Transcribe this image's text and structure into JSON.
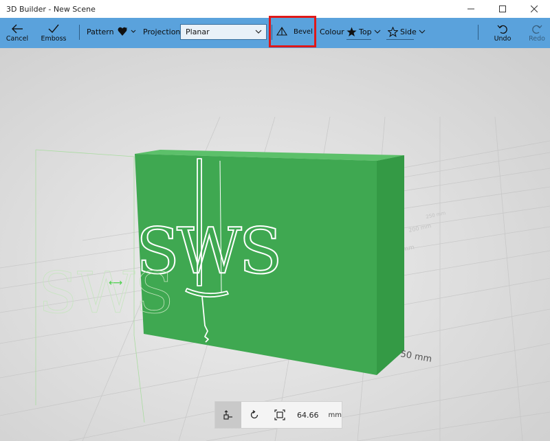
{
  "window": {
    "title": "3D Builder - New Scene"
  },
  "toolbar": {
    "cancel_label": "Cancel",
    "emboss_label": "Emboss",
    "pattern_label": "Pattern",
    "projection_label": "Projection",
    "projection_value": "Planar",
    "bevel_label": "Bevel",
    "colour_label": "Colour",
    "top_label": "Top",
    "side_label": "Side",
    "undo_label": "Undo",
    "redo_label": "Redo"
  },
  "scene": {
    "embossed_text": "SWS",
    "ruler_label": "50 mm",
    "grid_labels": [
      "mm",
      "200 mm",
      "250 mm"
    ],
    "box_color": "#3fa851"
  },
  "bottom_bar": {
    "value": "64.66",
    "unit": "mm"
  },
  "colors": {
    "toolbar": "#5aa2dc",
    "highlight": "#e01818",
    "background": "#dcdcdc"
  }
}
